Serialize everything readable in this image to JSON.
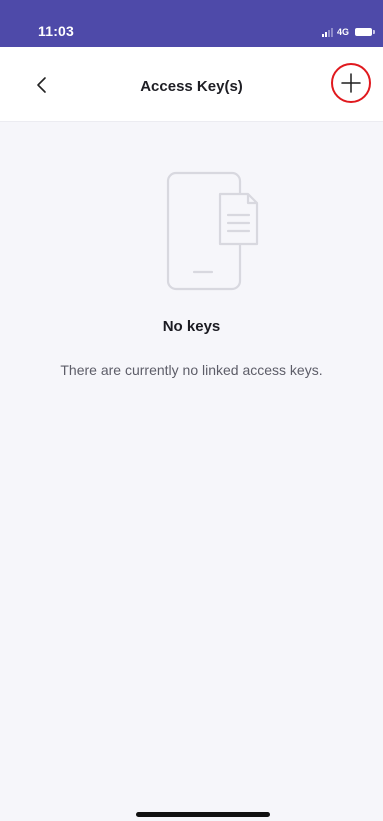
{
  "status_bar": {
    "time": "11:03",
    "network": "4G",
    "background_color": "#4e4aa9",
    "icons": [
      "signal-icon",
      "battery-icon"
    ]
  },
  "nav": {
    "title": "Access Key(s)",
    "back_icon": "chevron-left-icon",
    "add_icon": "plus-icon",
    "highlight_color": "#e0191e"
  },
  "empty_state": {
    "icon": "phone-document-icon",
    "title": "No keys",
    "message": "There are currently no linked access keys."
  }
}
